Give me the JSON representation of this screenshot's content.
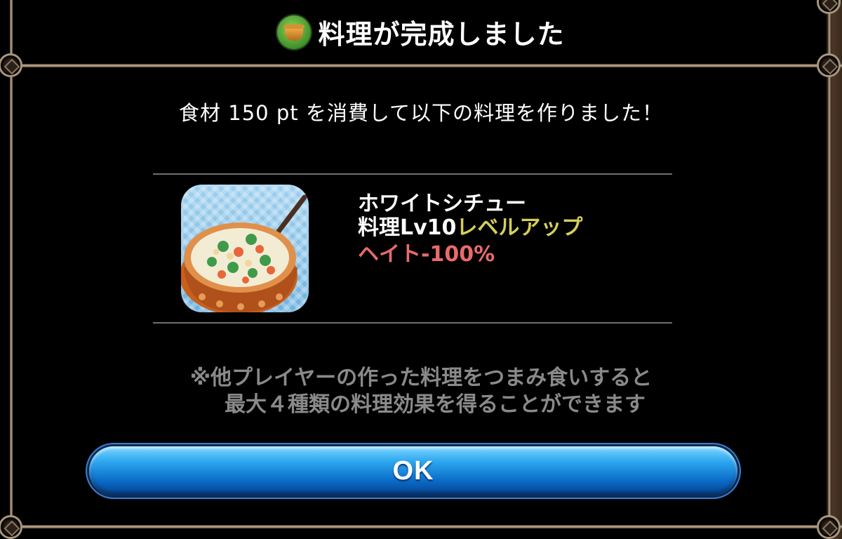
{
  "dialog": {
    "title": "料理が完成しました",
    "title_icon": "cooking-pot-icon"
  },
  "message": "食材 150 pt を消費して以下の料理を作りました！",
  "dish": {
    "name": "ホワイトシチュー",
    "level_text": "料理Lv10",
    "levelup_text": "レベルアップ",
    "effect": "ヘイト-100%",
    "image": "white-stew-dish-image"
  },
  "note": {
    "line1": "※他プレイヤーの作った料理をつまみ食いすると",
    "line2": "最大４種類の料理効果を得ることができます"
  },
  "ok_button": {
    "label": "OK"
  },
  "colors": {
    "background": "#000000",
    "levelup": "#d4cf5a",
    "effect": "#e86b6b",
    "note": "#8a8a8a",
    "button": "#1a8ae0",
    "border": "#b8a58c"
  }
}
